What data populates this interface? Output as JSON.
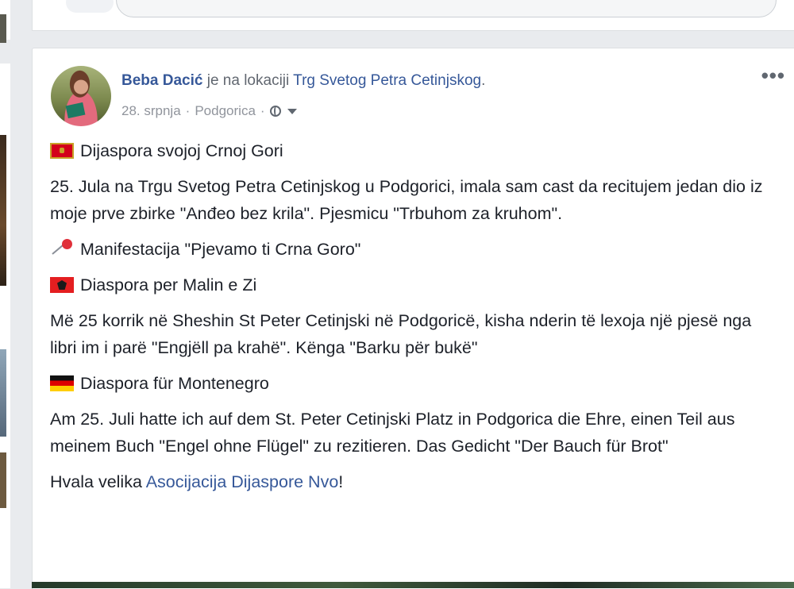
{
  "post": {
    "author": "Beba Dacić",
    "location_prefix": " je na lokaciji ",
    "location": "Trg Svetog Petra Cetinjskog",
    "location_suffix": ".",
    "date": "28. srpnja",
    "separator1": " · ",
    "city": "Podgorica",
    "separator2": " · ",
    "menu_glyph": "•••",
    "icons": {
      "privacy": "globe-icon",
      "menu": "more-options-icon"
    },
    "paragraphs": {
      "p1": "Dijaspora svojoj Crnoj Gori",
      "p2": "25. Jula na Trgu Svetog Petra Cetinjskog u Podgorici, imala sam cast da recitujem jedan dio iz moje prve zbirke \"Anđeo bez krila\". Pjesmicu \"Trbuhom za kruhom\".",
      "p3": "Manifestacija \"Pjevamo ti Crna Goro\"",
      "p4": "Diaspora per Malin e Zi",
      "p5": "Më 25 korrik në Sheshin St Peter Cetinjski në Podgoricë, kisha nderin të lexoja një pjesë nga libri im i parë \"Engjëll pa krahë\". Kënga \"Barku për bukë\"",
      "p6": "Diaspora für Montenegro",
      "p7": "Am 25. Juli hatte ich auf dem St. Peter Cetinjski Platz in Podgorica die Ehre, einen Teil aus meinem Buch \"Engel ohne Flügel\" zu rezitieren. Das Gedicht \"Der Bauch für Brot\"",
      "p8_prefix": "Hvala velika ",
      "p8_link": "Asocijacija Dijaspore Nvo",
      "p8_suffix": "!"
    }
  },
  "colors": {
    "link": "#365899",
    "text": "#1d2129",
    "meta": "#90949c",
    "page_bg": "#e9ebee"
  }
}
